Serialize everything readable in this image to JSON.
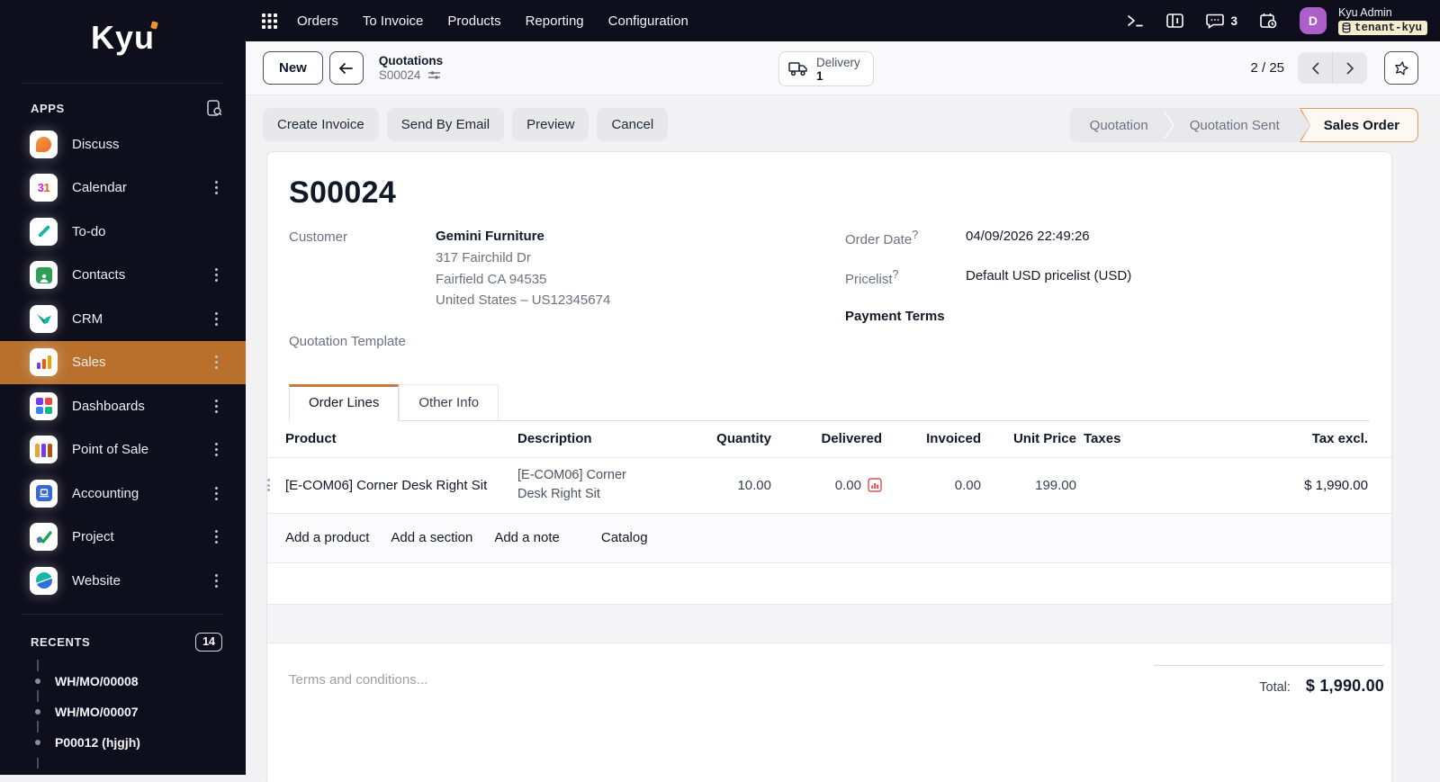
{
  "colors": {
    "topbar_bg": "#0e0e1d",
    "accent_orange": "#b9702d",
    "status_active_border": "#dd9a62",
    "status_active_bg": "#fdf8f1",
    "avatar_bg": "#ad5fc9",
    "tenant_badge_bg": "#f5edcb",
    "danger_red": "#d9534f"
  },
  "sidebar": {
    "logo": "Kyu",
    "apps_header": "APPS",
    "apps": [
      {
        "label": "Discuss",
        "icon": "discuss-app-icon"
      },
      {
        "label": "Calendar",
        "icon": "calendar-app-icon"
      },
      {
        "label": "To-do",
        "icon": "todo-app-icon"
      },
      {
        "label": "Contacts",
        "icon": "contacts-app-icon"
      },
      {
        "label": "CRM",
        "icon": "crm-app-icon"
      },
      {
        "label": "Sales",
        "icon": "sales-app-icon",
        "active": true
      },
      {
        "label": "Dashboards",
        "icon": "dashboards-app-icon"
      },
      {
        "label": "Point of Sale",
        "icon": "pos-app-icon"
      },
      {
        "label": "Accounting",
        "icon": "accounting-app-icon"
      },
      {
        "label": "Project",
        "icon": "project-app-icon"
      },
      {
        "label": "Website",
        "icon": "website-app-icon"
      }
    ],
    "calendar_icon_text": "31",
    "recents_header": "RECENTS",
    "recents_count": "14",
    "recents": [
      {
        "label": "WH/MO/00008"
      },
      {
        "label": "WH/MO/00007"
      },
      {
        "label": "P00012 (hjgjh)"
      }
    ]
  },
  "topbar": {
    "nav": [
      {
        "label": "Orders"
      },
      {
        "label": "To Invoice"
      },
      {
        "label": "Products"
      },
      {
        "label": "Reporting"
      },
      {
        "label": "Configuration"
      }
    ],
    "message_count": "3",
    "user": {
      "name": "Kyu Admin",
      "tenant": "tenant-kyu",
      "avatar_initial": "D"
    }
  },
  "control_bar": {
    "new_button": "New",
    "breadcrumb_parent": "Quotations",
    "breadcrumb_current": "S00024",
    "delivery_label": "Delivery",
    "delivery_count": "1",
    "pager": "2 / 25"
  },
  "actions": {
    "create_invoice": "Create Invoice",
    "send_by_email": "Send By Email",
    "preview": "Preview",
    "cancel": "Cancel"
  },
  "statusbar": {
    "steps": [
      {
        "label": "Quotation"
      },
      {
        "label": "Quotation Sent"
      },
      {
        "label": "Sales Order",
        "active": true
      }
    ]
  },
  "form": {
    "title": "S00024",
    "customer_label": "Customer",
    "customer_name": "Gemini Furniture",
    "address_line1": "317 Fairchild Dr",
    "address_line2": "Fairfield CA 94535",
    "address_line3": "United States – US12345674",
    "quotation_template_label": "Quotation Template",
    "order_date_label": "Order Date",
    "order_date_value": "04/09/2026 22:49:26",
    "pricelist_label": "Pricelist",
    "pricelist_value": "Default USD pricelist (USD)",
    "payment_terms_label": "Payment Terms",
    "help_marker": "?"
  },
  "tabs": {
    "order_lines": "Order Lines",
    "other_info": "Other Info"
  },
  "order_lines": {
    "columns": {
      "product": "Product",
      "description": "Description",
      "quantity": "Quantity",
      "delivered": "Delivered",
      "invoiced": "Invoiced",
      "unit_price": "Unit Price",
      "taxes": "Taxes",
      "tax_excl": "Tax excl."
    },
    "rows": [
      {
        "product": "[E-COM06] Corner Desk Right Sit",
        "description": "[E-COM06] Corner Desk Right Sit",
        "quantity": "10.00",
        "delivered": "0.00",
        "invoiced": "0.00",
        "unit_price": "199.00",
        "taxes": "",
        "subtotal": "$ 1,990.00"
      }
    ],
    "add_product": "Add a product",
    "add_section": "Add a section",
    "add_note": "Add a note",
    "catalog": "Catalog"
  },
  "footer": {
    "terms_placeholder": "Terms and conditions...",
    "total_label": "Total:",
    "total_value": "$ 1,990.00"
  }
}
